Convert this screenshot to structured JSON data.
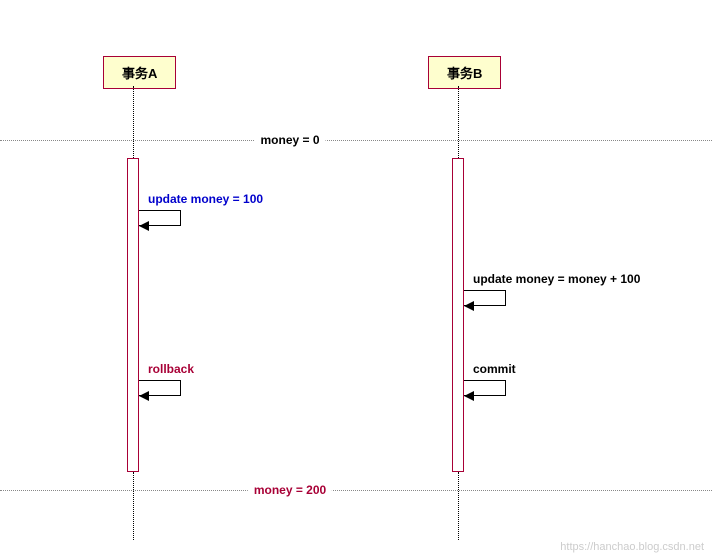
{
  "participants": {
    "a": {
      "label": "事务A"
    },
    "b": {
      "label": "事务B"
    }
  },
  "dividers": {
    "top": {
      "text": "money = 0",
      "color": "#000"
    },
    "bottom": {
      "text": "money = 200",
      "color": "#A80036"
    }
  },
  "messages": {
    "a_update": {
      "text": "update money = 100",
      "color": "#0000CC"
    },
    "a_rollback": {
      "text": "rollback",
      "color": "#A80036"
    },
    "b_update": {
      "text": "update money = money + 100",
      "color": "#000"
    },
    "b_commit": {
      "text": "commit",
      "color": "#000"
    }
  },
  "watermark": "https://hanchao.blog.csdn.net"
}
